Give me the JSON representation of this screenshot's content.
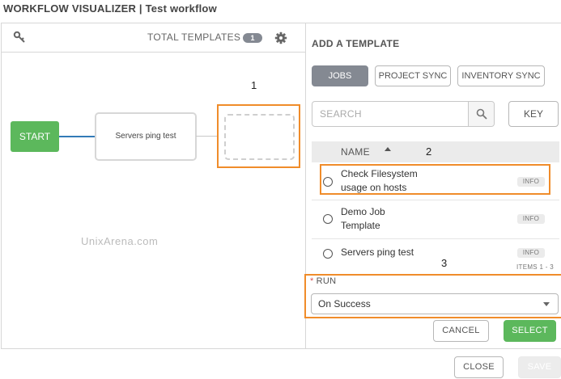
{
  "header": {
    "title": "WORKFLOW VISUALIZER | Test workflow"
  },
  "canvas": {
    "total_templates_label": "TOTAL TEMPLATES",
    "total_templates_count": "1",
    "start_node_label": "START",
    "job_node_label": "Servers ping test",
    "watermark": "UnixArena.com",
    "callouts": [
      "1",
      "2",
      "3"
    ]
  },
  "panel": {
    "title": "ADD A TEMPLATE",
    "tabs": [
      {
        "label": "JOBS",
        "active": true
      },
      {
        "label": "PROJECT SYNC",
        "active": false
      },
      {
        "label": "INVENTORY SYNC",
        "active": false
      }
    ],
    "search": {
      "placeholder": "SEARCH",
      "value": ""
    },
    "key_button": "KEY",
    "table": {
      "column_name": "NAME",
      "sort": "ascending",
      "rows": [
        {
          "name": "Check Filesystem usage on hosts",
          "info": "INFO",
          "selected": false
        },
        {
          "name": "Demo Job Template",
          "info": "INFO",
          "selected": false
        },
        {
          "name": "Servers ping test",
          "info": "INFO",
          "selected": false
        }
      ],
      "items_label": "ITEMS 1 - 3"
    },
    "run": {
      "required_marker": "*",
      "label": "RUN",
      "selected_value": "On Success"
    },
    "cancel_button": "CANCEL",
    "select_button": "SELECT"
  },
  "footer": {
    "close_button": "CLOSE",
    "save_button": "SAVE"
  },
  "colors": {
    "accent_green": "#5cb85c",
    "highlight_orange": "#f08c2a",
    "link_blue": "#337ab7",
    "tab_active": "#848992"
  }
}
